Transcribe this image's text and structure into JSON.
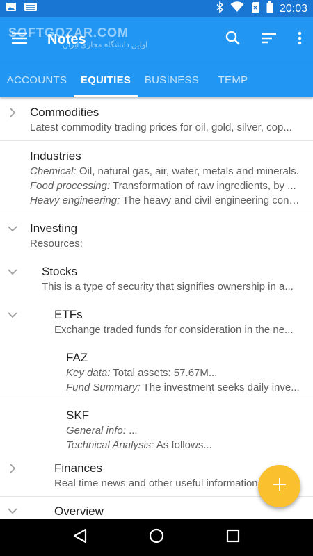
{
  "status_bar": {
    "time": "20:03"
  },
  "watermark": {
    "main": "SOFTGOZAR.COM",
    "sub": "اولین دانشگاه مجازی ایران"
  },
  "app_bar": {
    "title": "Notes"
  },
  "tabs": [
    {
      "label": "ACCOUNTS",
      "active": false
    },
    {
      "label": "EQUITIES",
      "active": true
    },
    {
      "label": "BUSINESS",
      "active": false
    },
    {
      "label": "TEMP",
      "active": false
    }
  ],
  "notes": [
    {
      "title": "Commodities",
      "chevron": "chevron-right",
      "lines": [
        {
          "label": "",
          "text": "Latest commodity trading prices for oil, gold, silver, cop..."
        }
      ]
    },
    {
      "title": "Industries",
      "chevron": "",
      "lines": [
        {
          "label": "Chemical:",
          "text": "Oil, natural gas, air, water, metals and minerals."
        },
        {
          "label": "Food processing:",
          "text": "Transformation of raw ingredients, by ..."
        },
        {
          "label": "Heavy engineering:",
          "text": "The heavy and civil engineering cons..."
        }
      ]
    },
    {
      "title": "Investing",
      "chevron": "chevron-down",
      "lines": [
        {
          "label": "",
          "text": "Resources:"
        }
      ]
    },
    {
      "title": "Stocks",
      "chevron": "chevron-down",
      "lines": [
        {
          "label": "",
          "text": "This is a type of security that signifies ownership in a..."
        }
      ]
    },
    {
      "title": "ETFs",
      "chevron": "chevron-down",
      "lines": [
        {
          "label": "",
          "text": "Exchange traded funds for consideration in the ne..."
        }
      ]
    },
    {
      "title": "FAZ",
      "chevron": "",
      "lines": [
        {
          "label": "Key data:",
          "text": "Total assets: 57.67M..."
        },
        {
          "label": "Fund Summary:",
          "text": "The investment seeks daily inve..."
        }
      ]
    },
    {
      "title": "SKF",
      "chevron": "",
      "lines": [
        {
          "label": "General info:",
          "text": "..."
        },
        {
          "label": "Technical Analysis:",
          "text": "As follows..."
        }
      ]
    },
    {
      "title": "Finances",
      "chevron": "chevron-right",
      "lines": [
        {
          "label": "",
          "text": "Real time news and other useful information"
        }
      ]
    },
    {
      "title": "Overview",
      "chevron": "chevron-down",
      "lines": []
    }
  ],
  "colors": {
    "primary": "#2196f3",
    "status_bar": "#1976d2",
    "fab": "#fbc02d",
    "nav_bar": "#000000"
  },
  "icons": [
    "image-icon",
    "stack-icon",
    "bluetooth-icon",
    "wifi-icon",
    "no-sim-icon",
    "battery-icon",
    "menu-icon",
    "search-icon",
    "sort-icon",
    "more-vert-icon",
    "chevron-right-icon",
    "chevron-down-icon",
    "add-icon",
    "back-icon",
    "home-icon",
    "recents-icon"
  ]
}
